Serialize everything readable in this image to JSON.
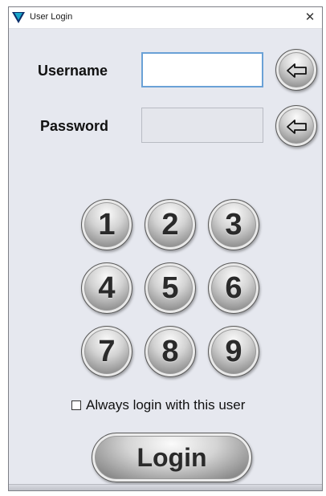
{
  "window": {
    "title": "User Login",
    "close_glyph": "✕"
  },
  "form": {
    "username_label": "Username",
    "username_value": "",
    "password_label": "Password",
    "password_value": "",
    "backspace_icon": "arrow-left-icon"
  },
  "keypad": {
    "keys": [
      "1",
      "2",
      "3",
      "4",
      "5",
      "6",
      "7",
      "8",
      "9"
    ]
  },
  "remember": {
    "label": "Always login with this user",
    "checked": false
  },
  "login_button": {
    "label": "Login"
  },
  "colors": {
    "window_bg": "#e6e8ef",
    "focus_border": "#6aa1d6",
    "app_icon": "#0c8fb0"
  }
}
